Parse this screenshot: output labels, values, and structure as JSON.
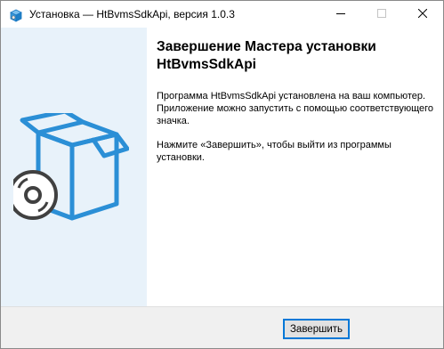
{
  "window": {
    "title": "Установка — HtBvmsSdkApi, версия 1.0.3"
  },
  "content": {
    "heading": "Завершение Мастера установки HtBvmsSdkApi",
    "paragraph_1": "Программа HtBvmsSdkApi установлена на ваш компьютер. Приложение можно запустить с помощью соответствующего значка.",
    "paragraph_2": "Нажмите «Завершить», чтобы выйти из программы установки."
  },
  "footer": {
    "finish_label": "Завершить"
  },
  "icons": {
    "app": "installer-box-icon",
    "minimize": "minimize-icon",
    "maximize": "maximize-icon",
    "close": "close-icon",
    "sidebar": "software-box-cd-icon"
  },
  "colors": {
    "sidebar_bg": "#e8f2fa",
    "accent_blue": "#2b8fd6",
    "footer_bg": "#f0f0f0",
    "button_border": "#0078d7"
  }
}
